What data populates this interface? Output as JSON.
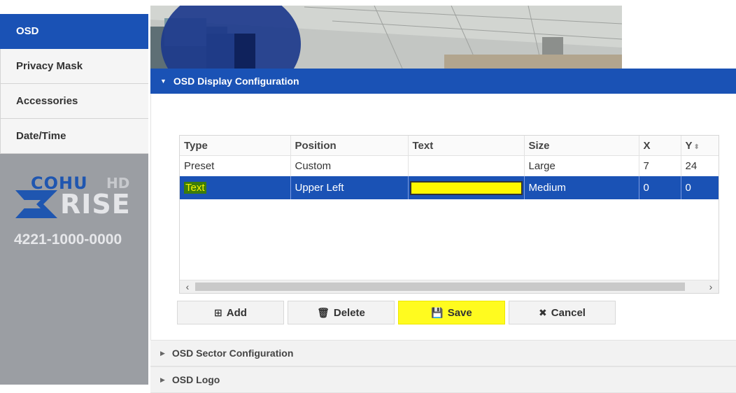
{
  "sidebar": {
    "items": [
      {
        "label": "OSD",
        "active": true
      },
      {
        "label": "Privacy Mask",
        "active": false
      },
      {
        "label": "Accessories",
        "active": false
      },
      {
        "label": "Date/Time",
        "active": false
      }
    ],
    "logo": {
      "brand": "COHU",
      "suffix": "HD",
      "product": "RISE"
    },
    "model": "4221-1000-0000"
  },
  "osd_display": {
    "title": "OSD Display Configuration",
    "columns": [
      "Type",
      "Position",
      "Text",
      "Size",
      "X",
      "Y"
    ],
    "rows": [
      {
        "type": "Preset",
        "position": "Custom",
        "text": "",
        "size": "Large",
        "x": "7",
        "y": "24"
      },
      {
        "type": "Text",
        "position": "Upper Left",
        "text": "",
        "size": "Medium",
        "x": "0",
        "y": "0"
      }
    ],
    "buttons": {
      "add": "Add",
      "delete": "Delete",
      "save": "Save",
      "cancel": "Cancel"
    }
  },
  "sections": {
    "sector": "OSD Sector Configuration",
    "logo": "OSD Logo"
  },
  "colors": {
    "accent": "#1a52b5",
    "highlight": "#fffb1f"
  }
}
